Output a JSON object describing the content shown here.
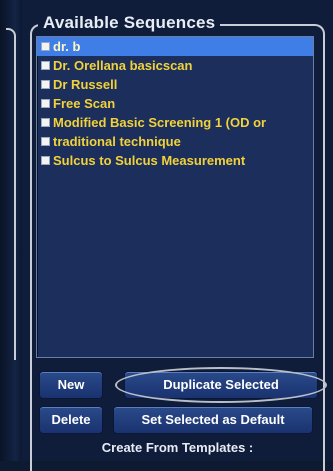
{
  "sequences_panel": {
    "title": "Available Sequences",
    "items": [
      {
        "label": "dr. b",
        "selected": true
      },
      {
        "label": "Dr. Orellana basicscan",
        "selected": false
      },
      {
        "label": "Dr Russell",
        "selected": false
      },
      {
        "label": "Free Scan",
        "selected": false
      },
      {
        "label": "Modified Basic Screening 1 (OD or",
        "selected": false
      },
      {
        "label": "traditional technique",
        "selected": false
      },
      {
        "label": "Sulcus to Sulcus Measurement",
        "selected": false
      }
    ]
  },
  "buttons": {
    "new_label": "New",
    "duplicate_label": "Duplicate Selected",
    "delete_label": "Delete",
    "set_default_label": "Set Selected as Default"
  },
  "templates_label": "Create From Templates :"
}
